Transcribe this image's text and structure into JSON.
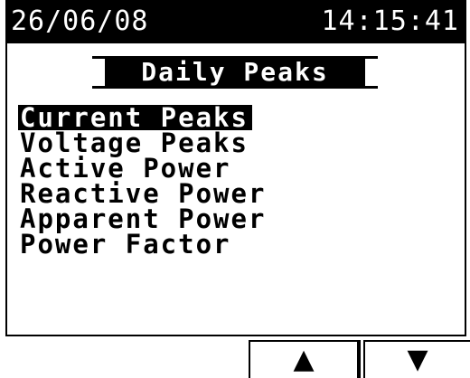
{
  "status_bar": {
    "date": "26/06/08",
    "time": "14:15:41"
  },
  "screen": {
    "title": "Daily Peaks"
  },
  "menu": {
    "items": [
      {
        "label": "Current Peaks",
        "selected": true
      },
      {
        "label": "Voltage Peaks",
        "selected": false
      },
      {
        "label": "Active Power",
        "selected": false
      },
      {
        "label": "Reactive Power",
        "selected": false
      },
      {
        "label": "Apparent Power",
        "selected": false
      },
      {
        "label": "Power Factor",
        "selected": false
      }
    ]
  },
  "buttons": {
    "up_icon": "up-arrow-icon",
    "up_glyph": "▲",
    "down_icon": "down-arrow-icon",
    "down_glyph": "▼"
  },
  "colors": {
    "foreground": "#000000",
    "background": "#ffffff"
  }
}
